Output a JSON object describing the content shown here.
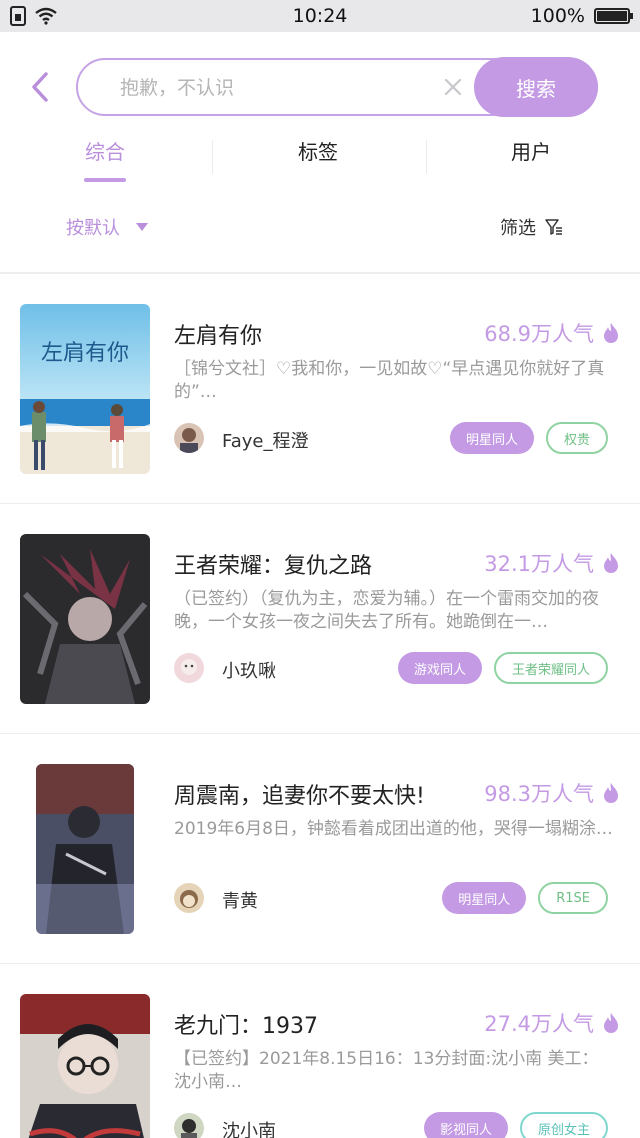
{
  "status_bar": {
    "time": "10:24",
    "battery": "100%",
    "battery_level": 1.0
  },
  "search": {
    "placeholder": "抱歉，不认识",
    "button_label": "搜索"
  },
  "tabs": [
    {
      "label": "综合",
      "active": true
    },
    {
      "label": "标签",
      "active": false
    },
    {
      "label": "用户",
      "active": false
    }
  ],
  "filter": {
    "sort_label": "按默认",
    "filter_label": "筛选"
  },
  "colors": {
    "accent": "#c39ae3",
    "accent_text": "#b98fdc",
    "tag_green": "#8fd3a2",
    "tag_teal": "#7fd6cf"
  },
  "books": [
    {
      "title": "左肩有你",
      "popularity": "68.9万人气",
      "description": "［锦兮文社］♡我和你，一见如故♡“早点遇见你就好了真的”…",
      "author": "Faye_程澄",
      "cover_text": "左肩有你",
      "tags": [
        {
          "label": "明星同人",
          "style": "filled"
        },
        {
          "label": "权贵",
          "style": "green"
        }
      ]
    },
    {
      "title": "王者荣耀：复仇之路",
      "popularity": "32.1万人气",
      "description": "（已签约）（复仇为主，恋爱为辅。）在一个雷雨交加的夜晚，一个女孩一夜之间失去了所有。她跪倒在一…",
      "author": "小玖啾",
      "tags": [
        {
          "label": "游戏同人",
          "style": "filled"
        },
        {
          "label": "王者荣耀同人",
          "style": "green"
        }
      ]
    },
    {
      "title": "周震南，追妻你不要太快!",
      "popularity": "98.3万人气",
      "description": "2019年6月8日，钟懿看着成团出道的他，哭得一塌糊涂…",
      "author": "青黄",
      "tags": [
        {
          "label": "明星同人",
          "style": "filled"
        },
        {
          "label": "R1SE",
          "style": "green"
        }
      ]
    },
    {
      "title": "老九门：1937",
      "popularity": "27.4万人气",
      "description": "【已签约】2021年8.15日16：13分封面:沈小南 美工：沈小南…",
      "author": "沈小南",
      "tags": [
        {
          "label": "影视同人",
          "style": "filled"
        },
        {
          "label": "原创女主",
          "style": "teal"
        }
      ]
    }
  ]
}
